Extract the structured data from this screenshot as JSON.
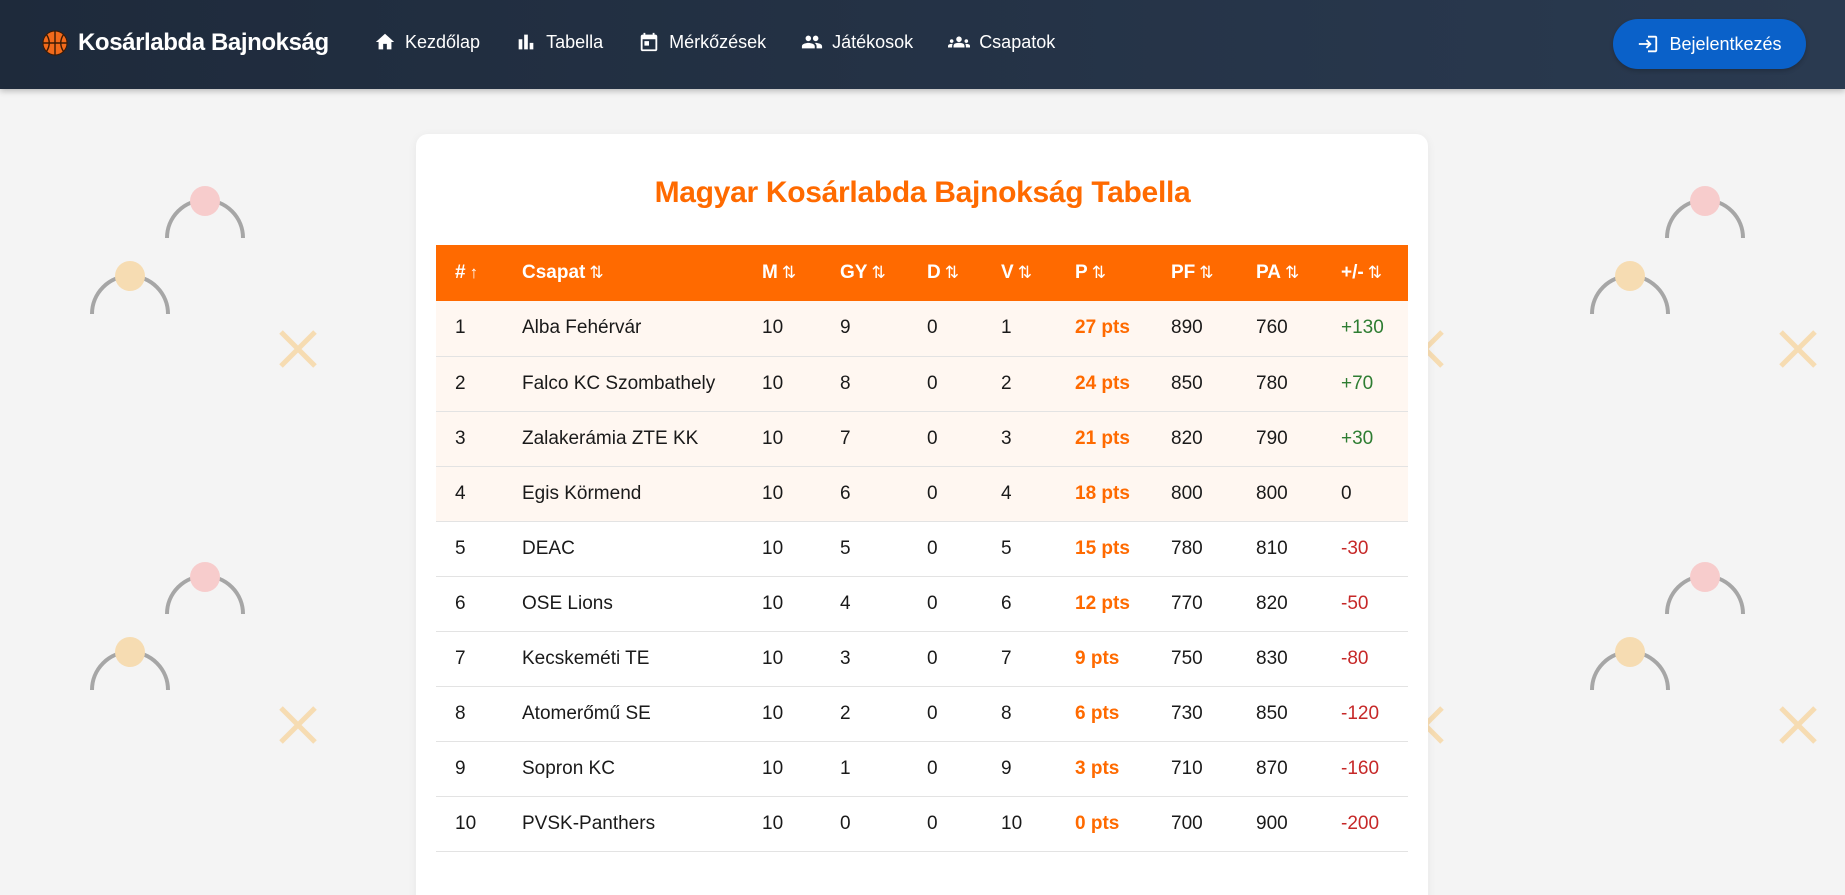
{
  "brand": {
    "name": "Kosárlabda Bajnokság",
    "icon": "basketball-icon"
  },
  "nav": [
    {
      "label": "Kezdőlap",
      "icon": "home-icon"
    },
    {
      "label": "Tabella",
      "icon": "bar-chart-icon"
    },
    {
      "label": "Mérkőzések",
      "icon": "calendar-icon"
    },
    {
      "label": "Játékosok",
      "icon": "people-icon"
    },
    {
      "label": "Csapatok",
      "icon": "groups-icon"
    }
  ],
  "login": {
    "label": "Bejelentkezés",
    "icon": "login-icon"
  },
  "page_title": "Magyar Kosárlabda Bajnokság Tabella",
  "table": {
    "headers": [
      {
        "label": "#",
        "sort": "↑"
      },
      {
        "label": "Csapat",
        "sort": "⇅"
      },
      {
        "label": "M",
        "sort": "⇅"
      },
      {
        "label": "GY",
        "sort": "⇅"
      },
      {
        "label": "D",
        "sort": "⇅"
      },
      {
        "label": "V",
        "sort": "⇅"
      },
      {
        "label": "P",
        "sort": "⇅"
      },
      {
        "label": "PF",
        "sort": "⇅"
      },
      {
        "label": "PA",
        "sort": "⇅"
      },
      {
        "label": "+/-",
        "sort": "⇅"
      }
    ],
    "rows": [
      {
        "rank": "1",
        "team": "Alba Fehérvár",
        "m": "10",
        "gy": "9",
        "d": "0",
        "v": "1",
        "p": "27 pts",
        "pf": "890",
        "pa": "760",
        "diff": "+130"
      },
      {
        "rank": "2",
        "team": "Falco KC Szombathely",
        "m": "10",
        "gy": "8",
        "d": "0",
        "v": "2",
        "p": "24 pts",
        "pf": "850",
        "pa": "780",
        "diff": "+70"
      },
      {
        "rank": "3",
        "team": "Zalakerámia ZTE KK",
        "m": "10",
        "gy": "7",
        "d": "0",
        "v": "3",
        "p": "21 pts",
        "pf": "820",
        "pa": "790",
        "diff": "+30"
      },
      {
        "rank": "4",
        "team": "Egis Körmend",
        "m": "10",
        "gy": "6",
        "d": "0",
        "v": "4",
        "p": "18 pts",
        "pf": "800",
        "pa": "800",
        "diff": "0"
      },
      {
        "rank": "5",
        "team": "DEAC",
        "m": "10",
        "gy": "5",
        "d": "0",
        "v": "5",
        "p": "15 pts",
        "pf": "780",
        "pa": "810",
        "diff": "-30"
      },
      {
        "rank": "6",
        "team": "OSE Lions",
        "m": "10",
        "gy": "4",
        "d": "0",
        "v": "6",
        "p": "12 pts",
        "pf": "770",
        "pa": "820",
        "diff": "-50"
      },
      {
        "rank": "7",
        "team": "Kecskeméti TE",
        "m": "10",
        "gy": "3",
        "d": "0",
        "v": "7",
        "p": "9 pts",
        "pf": "750",
        "pa": "830",
        "diff": "-80"
      },
      {
        "rank": "8",
        "team": "Atomerőmű SE",
        "m": "10",
        "gy": "2",
        "d": "0",
        "v": "8",
        "p": "6 pts",
        "pf": "730",
        "pa": "850",
        "diff": "-120"
      },
      {
        "rank": "9",
        "team": "Sopron KC",
        "m": "10",
        "gy": "1",
        "d": "0",
        "v": "9",
        "p": "3 pts",
        "pf": "710",
        "pa": "870",
        "diff": "-160"
      },
      {
        "rank": "10",
        "team": "PVSK-Panthers",
        "m": "10",
        "gy": "0",
        "d": "0",
        "v": "10",
        "p": "0 pts",
        "pf": "700",
        "pa": "900",
        "diff": "-200"
      }
    ]
  },
  "colors": {
    "accent": "#ff6a00",
    "header_bg": "#1e2a3b",
    "login_button": "#0a61c9",
    "positive": "#2e7d32",
    "negative": "#c62828",
    "highlight_row": "#fff7f1"
  }
}
